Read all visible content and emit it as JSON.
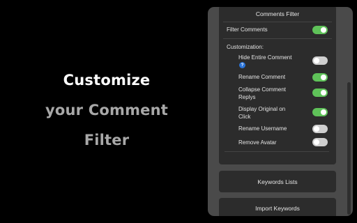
{
  "hero": {
    "line1": "Customize",
    "line2": "your Comment",
    "line3": "Filter"
  },
  "popup": {
    "header": "Comments Filter",
    "filter_comments": {
      "label": "Filter Comments",
      "on": true
    },
    "customization_label": "Customization:",
    "options": [
      {
        "label": "Hide Entire Comment",
        "on": false,
        "help_icon": "question-mark"
      },
      {
        "label": "Rename Comment",
        "on": true
      },
      {
        "label": "Collapse Comment Replys",
        "on": true
      },
      {
        "label": "Display Original on Click",
        "on": true
      },
      {
        "label": "Rename Username",
        "on": false
      },
      {
        "label": "Remove Avatar",
        "on": false
      }
    ],
    "keywords_lists": "Keywords Lists",
    "import_keywords": "Import Keywords"
  },
  "help_glyph": "?",
  "colors": {
    "background": "#000000",
    "panel": "#4a4a4a",
    "card": "#2c2c2c",
    "toggle_on": "#5fc259",
    "toggle_off": "#cfcfcf",
    "help_icon": "#2b74d8"
  }
}
